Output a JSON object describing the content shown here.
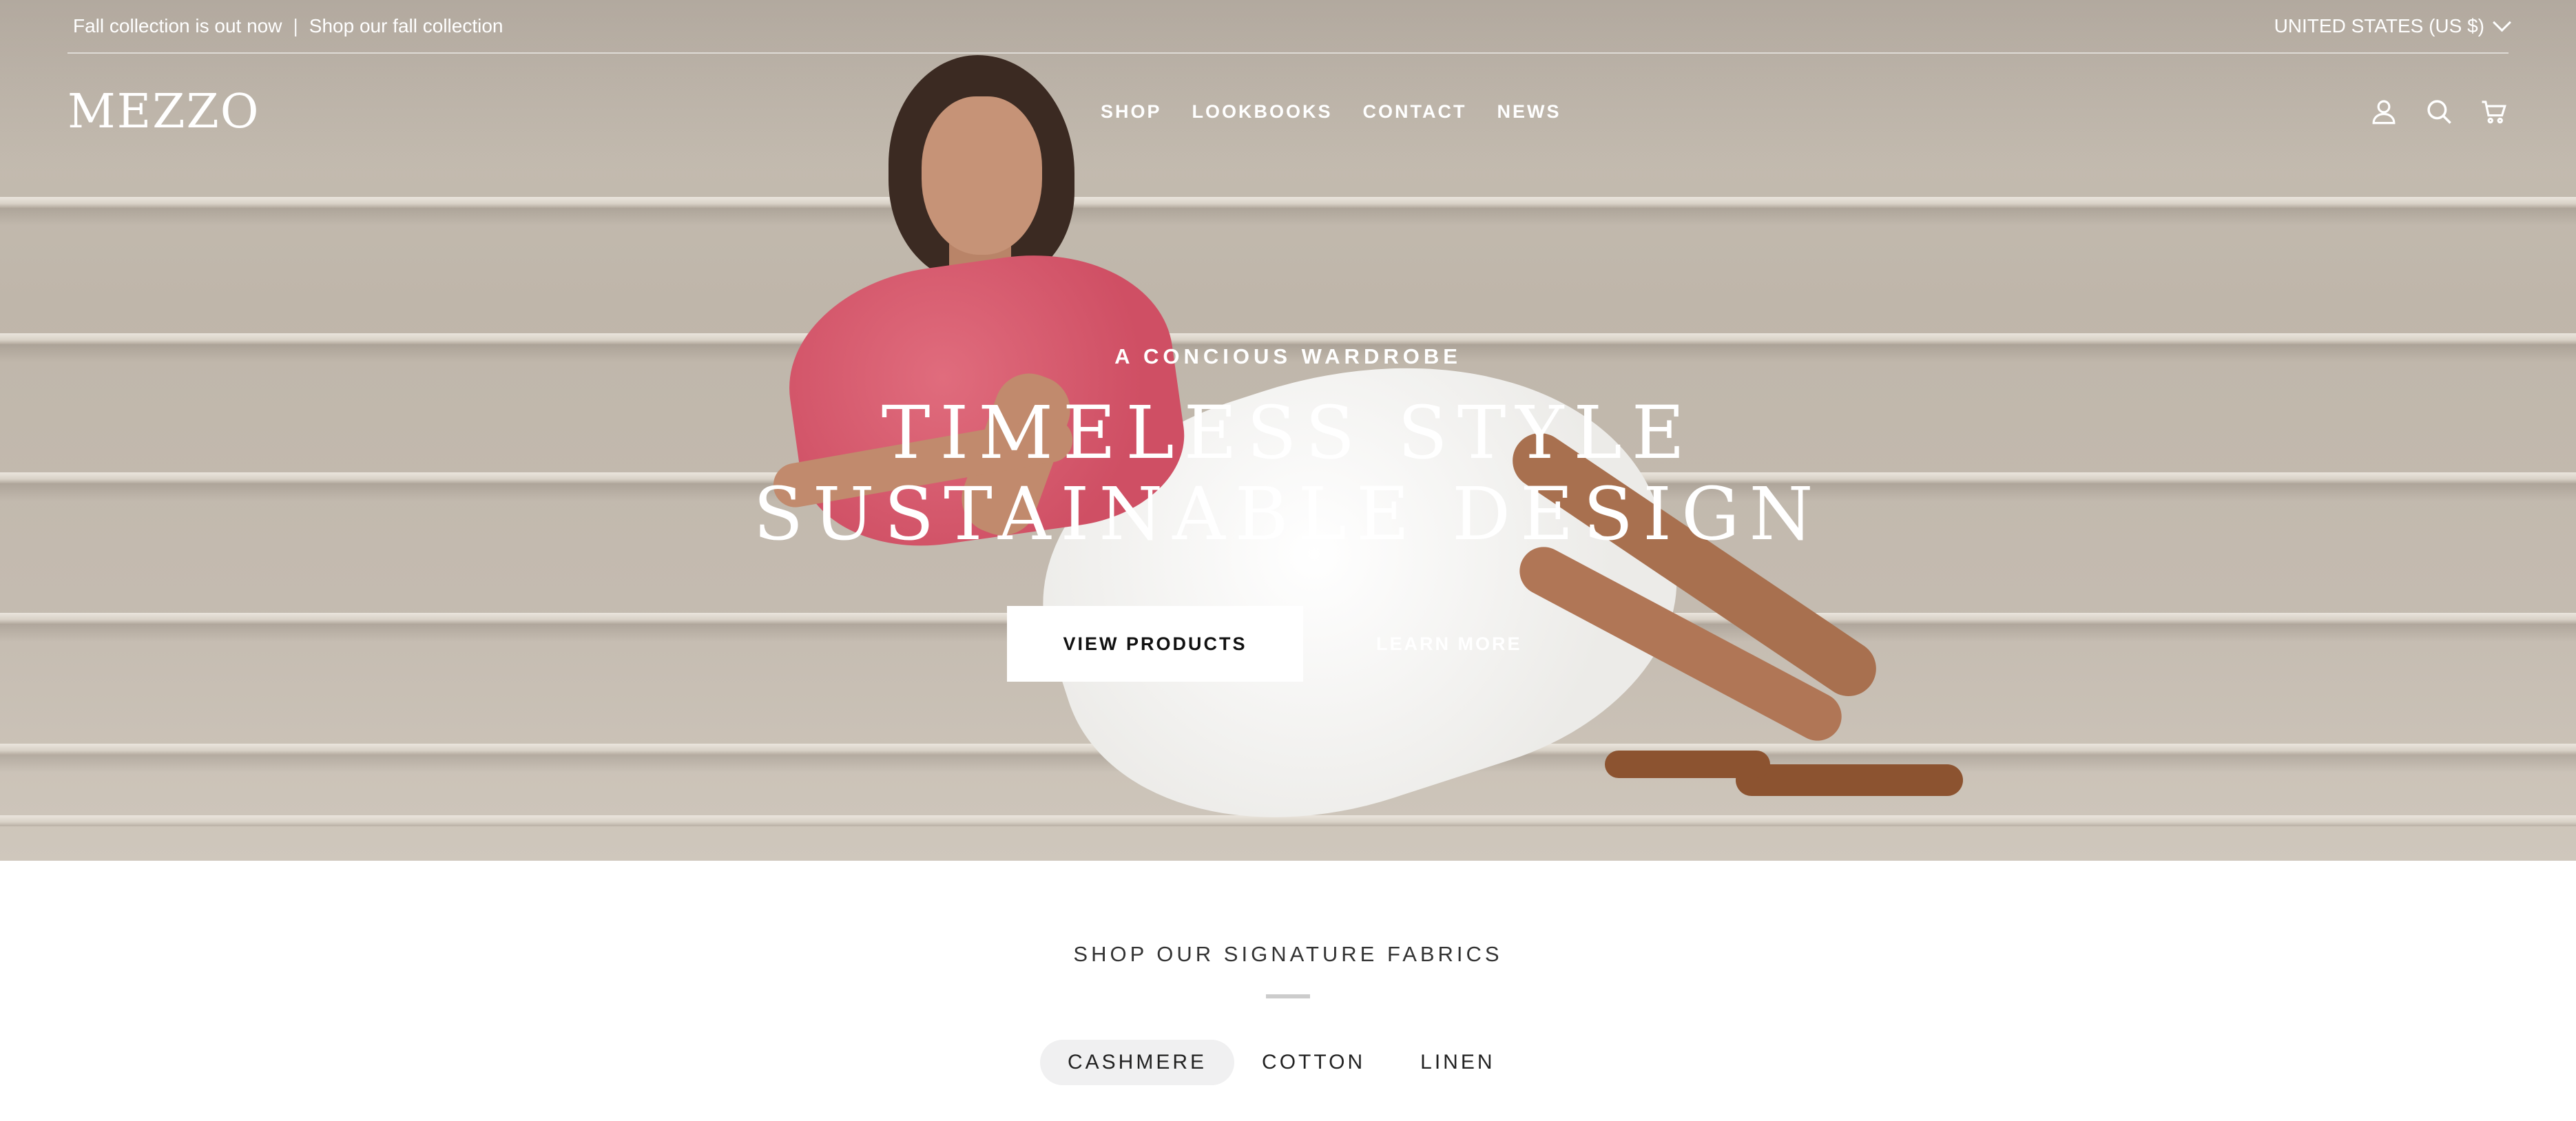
{
  "announcement": {
    "message": "Fall collection is out now",
    "separator": "|",
    "link_label": "Shop our fall collection",
    "region_label": "UNITED STATES (US $)"
  },
  "header": {
    "logo": "MEZZO",
    "nav": [
      "SHOP",
      "LOOKBOOKS",
      "CONTACT",
      "NEWS"
    ],
    "icons": [
      "account-icon",
      "search-icon",
      "cart-icon"
    ]
  },
  "hero": {
    "eyebrow": "A CONCIOUS WARDROBE",
    "headline": "TIMELESS STYLE SUSTAINABLE DESIGN",
    "primary_cta": "VIEW PRODUCTS",
    "secondary_cta": "LEARN MORE"
  },
  "fabrics": {
    "title": "SHOP OUR SIGNATURE FABRICS",
    "tabs": [
      "CASHMERE",
      "COTTON",
      "LINEN"
    ],
    "active_tab": "CASHMERE"
  },
  "colors": {
    "hero_overlay_text": "#ffffff",
    "button_bg": "#ffffff",
    "active_tab_bg": "#f0f0f1"
  }
}
